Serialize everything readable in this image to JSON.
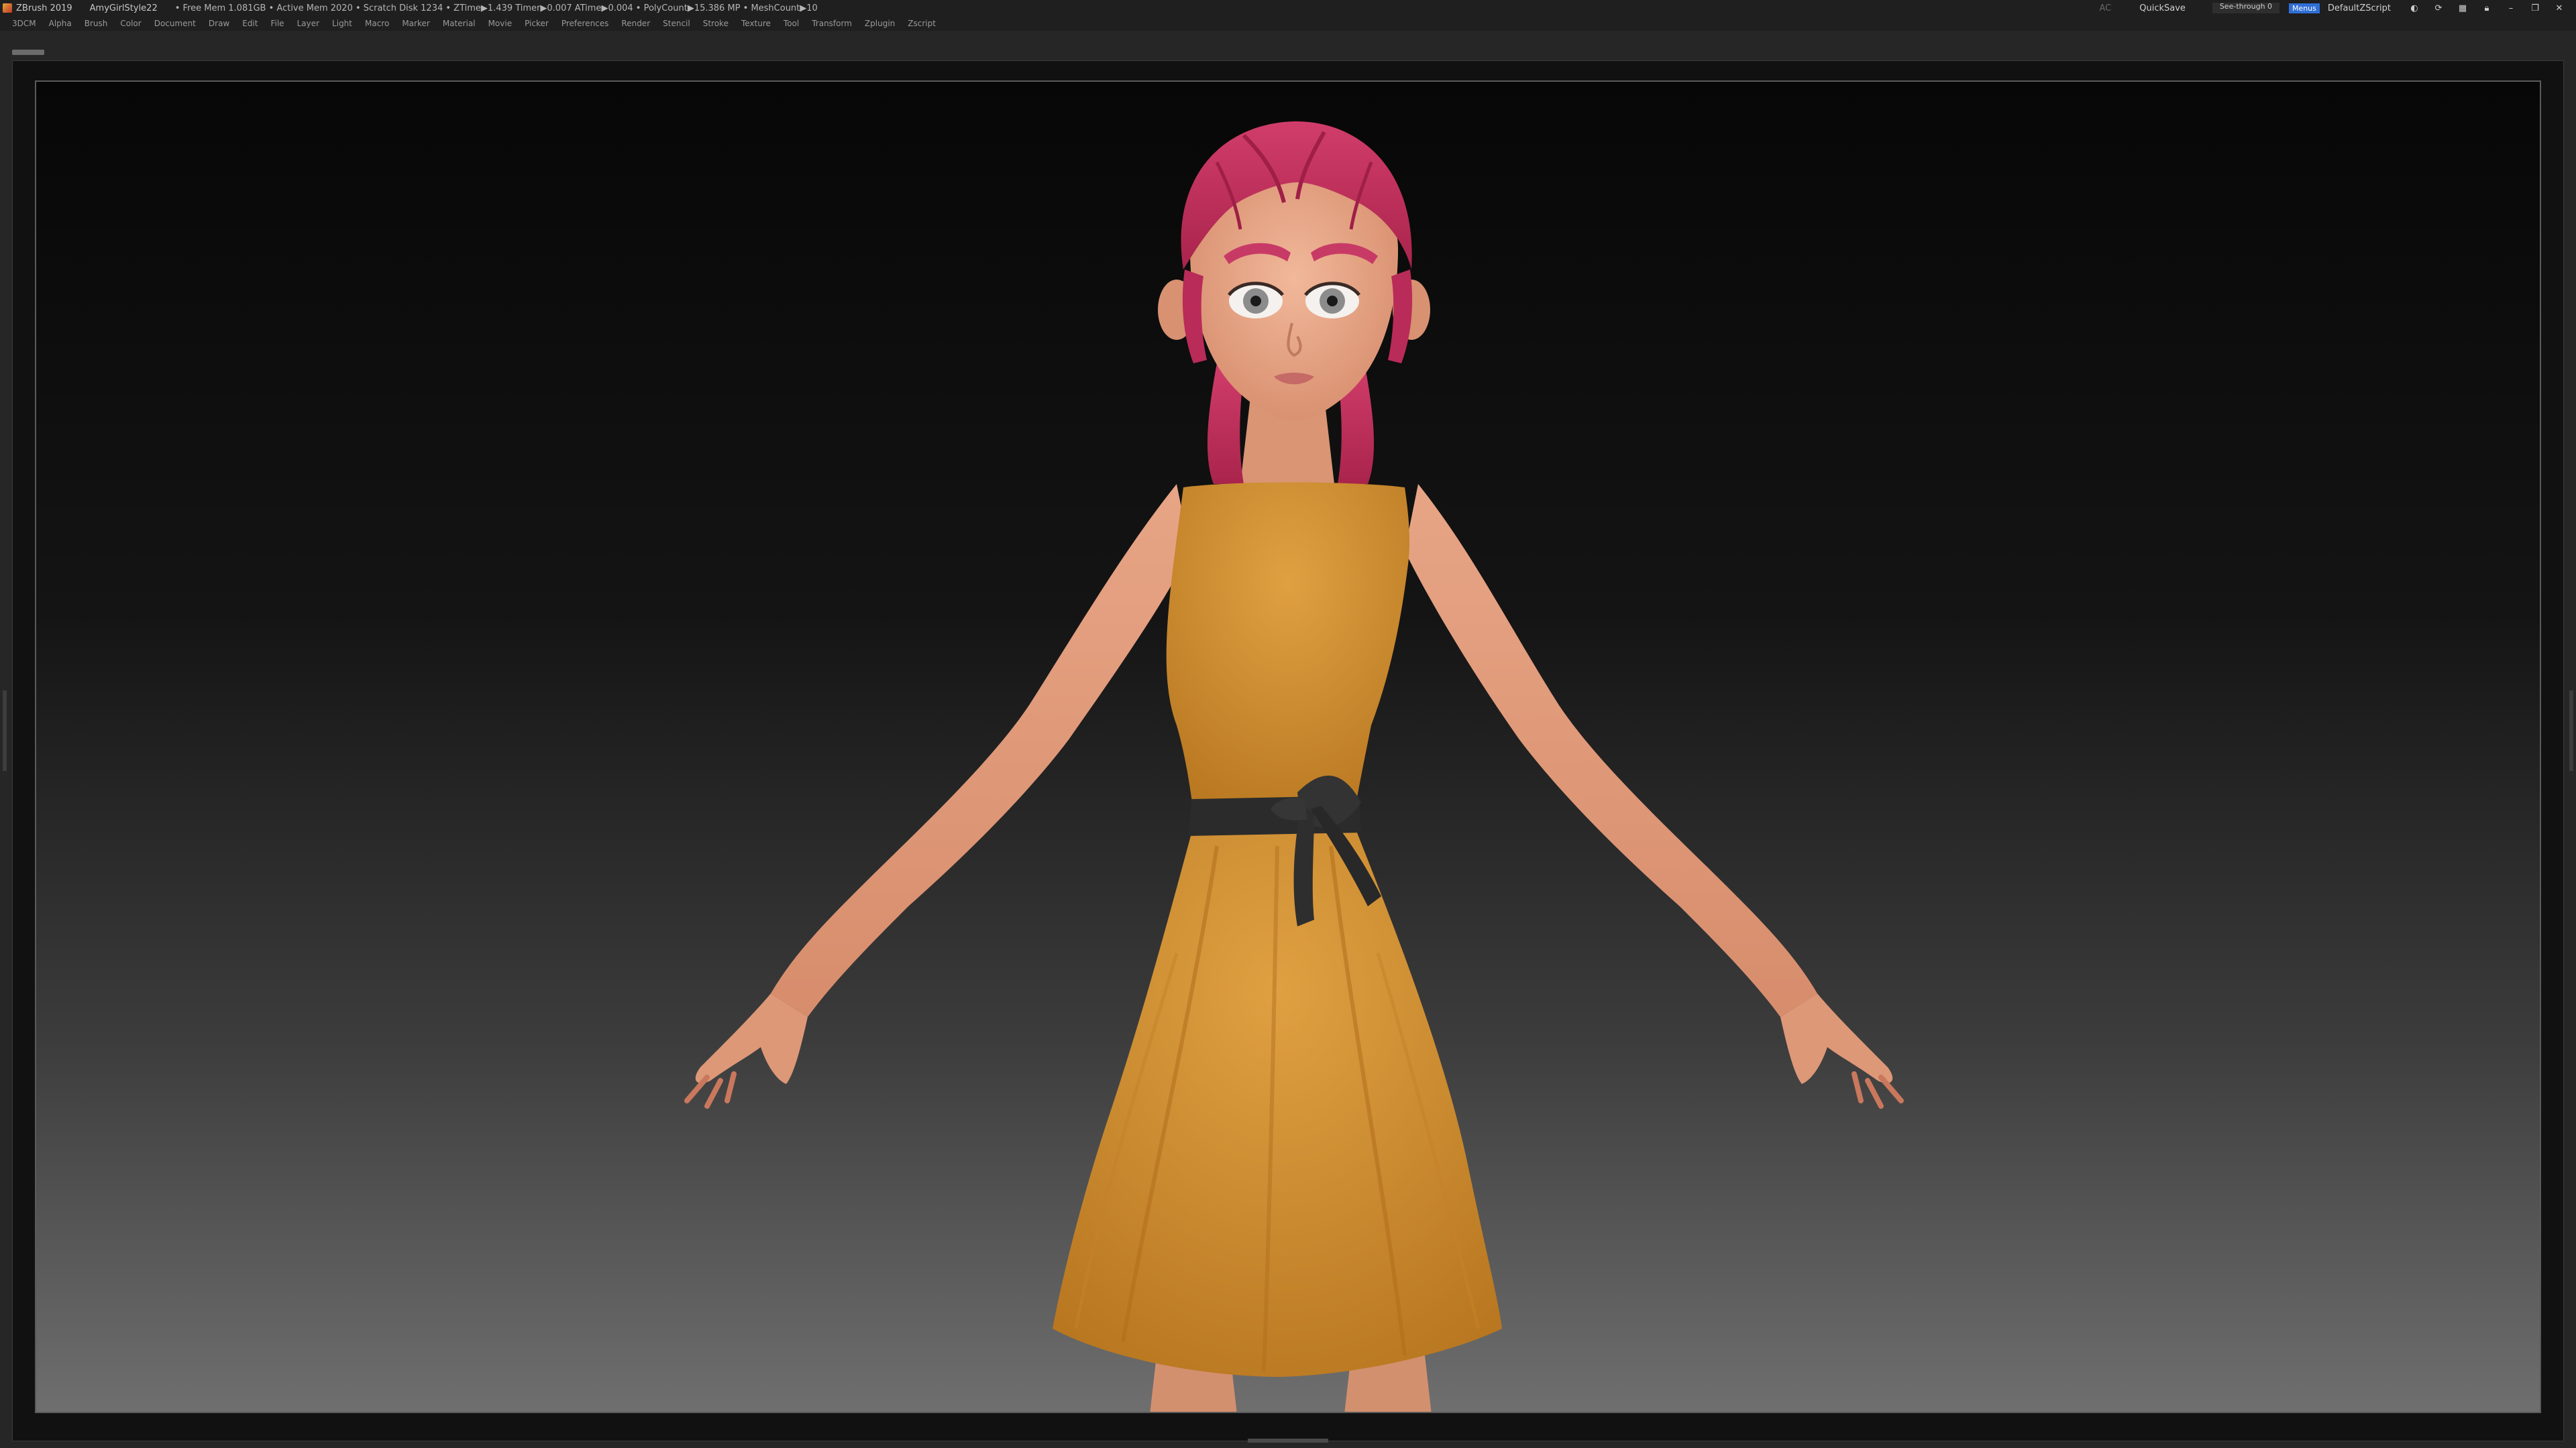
{
  "titlebar": {
    "app_name": "ZBrush 2019",
    "document": "AmyGirlStyle22",
    "stats": "• Free Mem 1.081GB • Active Mem 2020 • Scratch Disk 1234 • ZTime▶1.439 Timer▶0.007 ATime▶0.004 • PolyCount▶15.386 MP • MeshCount▶10"
  },
  "toolbar_right": {
    "ac_label": "AC",
    "quicksave_label": "QuickSave",
    "see_through_label": "See-through 0",
    "see_through_value": 0,
    "menus_label": "Menus",
    "zscript_label": "DefaultZScript",
    "icons": [
      "palette-icon",
      "sync-icon",
      "layout-icon",
      "lock-icon",
      "minimize-icon",
      "restore-icon",
      "close-icon"
    ]
  },
  "menubar": {
    "items": [
      "3DCM",
      "Alpha",
      "Brush",
      "Color",
      "Document",
      "Draw",
      "Edit",
      "File",
      "Layer",
      "Light",
      "Macro",
      "Marker",
      "Material",
      "Movie",
      "Picker",
      "Preferences",
      "Render",
      "Stencil",
      "Stroke",
      "Texture",
      "Tool",
      "Transform",
      "Zplugin",
      "Zscript"
    ]
  },
  "colors": {
    "ui_bg": "#262626",
    "bar_bg": "#1f1f1f",
    "accent_blue": "#2f6fd6",
    "skin": "#e2a07e",
    "dress": "#d4922f",
    "hair": "#c7305f",
    "belt": "#2a2a2a"
  }
}
